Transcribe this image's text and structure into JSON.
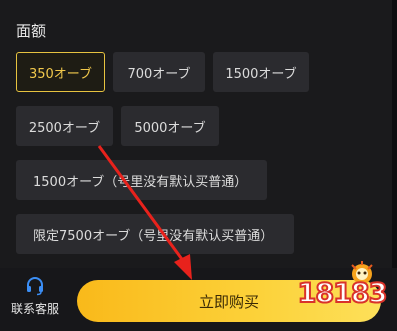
{
  "section": {
    "title": "面额"
  },
  "options": [
    {
      "label": "350オーブ",
      "selected": true
    },
    {
      "label": "700オーブ",
      "selected": false
    },
    {
      "label": "1500オーブ",
      "selected": false
    },
    {
      "label": "2500オーブ",
      "selected": false
    },
    {
      "label": "5000オーブ",
      "selected": false
    },
    {
      "label": "1500オーブ（号里没有默认买普通）",
      "selected": false
    },
    {
      "label": "限定7500オーブ（号里没有默认买普通）",
      "selected": false
    }
  ],
  "footer": {
    "service_label": "联系客服",
    "buy_label": "立即购买"
  },
  "watermark": {
    "text": "18183"
  },
  "icons": {
    "service": "headset-icon",
    "annotation": "red-arrow-icon"
  },
  "colors": {
    "accent": "#e7c340",
    "buy_gradient_start": "#f9b91a",
    "buy_gradient_end": "#fde05a",
    "arrow": "#e8221c"
  }
}
